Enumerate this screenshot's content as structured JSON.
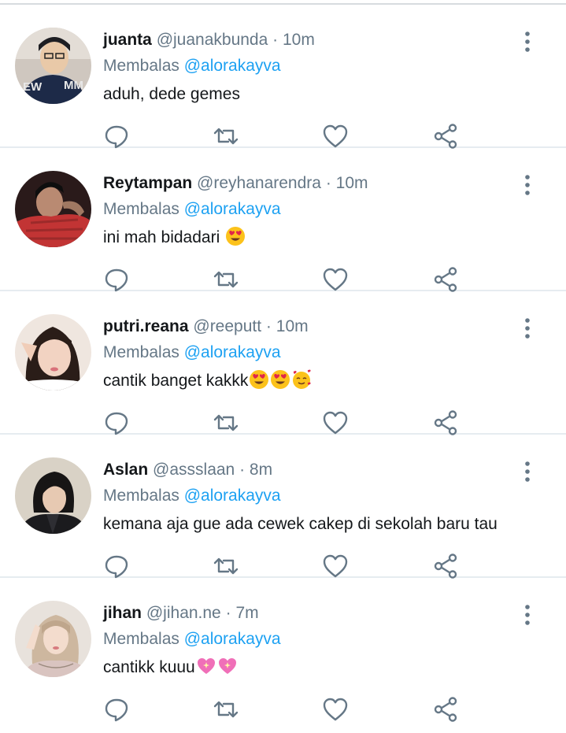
{
  "colors": {
    "name": "#14171a",
    "muted": "#657786",
    "link": "#1da1f2",
    "divider": "#e6ecf0"
  },
  "icons": {
    "reply": "reply-icon",
    "retweet": "retweet-icon",
    "like": "heart-icon",
    "share": "share-icon",
    "more": "more-vertical-icon"
  },
  "tweets": [
    {
      "name": "juanta",
      "handle": "@juanakbunda",
      "dot": "·",
      "time": "10m",
      "reply_prefix": "Membalas",
      "mention": "@alorakayva",
      "text": "aduh, dede gemes",
      "emojis": []
    },
    {
      "name": "Reytampan",
      "handle": "@reyhanarendra",
      "dot": "·",
      "time": "10m",
      "reply_prefix": "Membalas",
      "mention": "@alorakayva",
      "text": "ini mah bidadari ",
      "emojis": [
        "heart-eyes"
      ]
    },
    {
      "name": "putri.reana",
      "handle": "@reeputt",
      "dot": "·",
      "time": "10m",
      "reply_prefix": "Membalas",
      "mention": "@alorakayva",
      "text": "cantik banget kakkk",
      "emojis": [
        "heart-eyes",
        "heart-eyes",
        "smiling-hearts"
      ]
    },
    {
      "name": "Aslan",
      "handle": "@assslaan",
      "dot": "·",
      "time": "8m",
      "reply_prefix": "Membalas",
      "mention": "@alorakayva",
      "text": "kemana aja gue ada cewek cakep di sekolah baru tau",
      "emojis": []
    },
    {
      "name": "jihan",
      "handle": "@jihan.ne",
      "dot": "·",
      "time": "7m",
      "reply_prefix": "Membalas",
      "mention": "@alorakayva",
      "text": "cantikk kuuu",
      "emojis": [
        "sparkling-heart",
        "sparkling-heart"
      ]
    }
  ]
}
